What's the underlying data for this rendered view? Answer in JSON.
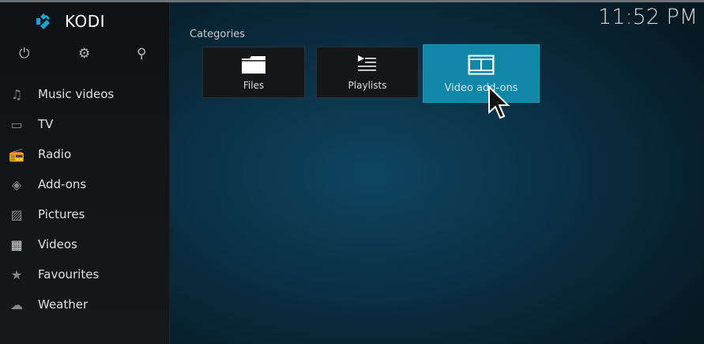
{
  "app": {
    "name": "KODI",
    "clock": "11:52 PM"
  },
  "top_icons": [
    "power-icon",
    "settings-icon",
    "search-icon"
  ],
  "sidebar": {
    "items": [
      {
        "label": "Music videos",
        "icon": "music-video-icon"
      },
      {
        "label": "TV",
        "icon": "tv-icon"
      },
      {
        "label": "Radio",
        "icon": "radio-icon"
      },
      {
        "label": "Add-ons",
        "icon": "addons-icon"
      },
      {
        "label": "Pictures",
        "icon": "pictures-icon"
      },
      {
        "label": "Videos",
        "icon": "film-icon"
      },
      {
        "label": "Favourites",
        "icon": "star-icon"
      },
      {
        "label": "Weather",
        "icon": "weather-icon"
      }
    ]
  },
  "main": {
    "section_title": "Categories",
    "tiles": [
      {
        "label": "Files",
        "icon": "folder-icon"
      },
      {
        "label": "Playlists",
        "icon": "playlist-icon"
      },
      {
        "label": "Video add-ons",
        "icon": "film-icon",
        "focused": true
      }
    ]
  },
  "colors": {
    "accent": "#1087a7",
    "logo": "#17a5d6"
  }
}
